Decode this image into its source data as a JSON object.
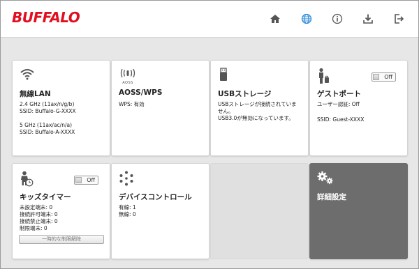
{
  "header": {
    "logo": "BUFFALO",
    "nav_icons": [
      "home-icon",
      "globe-icon",
      "info-icon",
      "download-icon",
      "logout-icon"
    ],
    "accent_color": "#e10f1f",
    "globe_color": "#2a8ad8"
  },
  "cards": {
    "wireless": {
      "title": "無線LAN",
      "band24": "2.4 GHz (11ax/n/g/b)",
      "ssid24": "SSID: Buffalo-G-XXXX",
      "band5": "5 GHz (11ax/ac/n/a)",
      "ssid5": "SSID: Buffalo-A-XXXX"
    },
    "aoss": {
      "icon_caption": "AOSS",
      "title": "AOSS/WPS",
      "wps": "WPS: 有効"
    },
    "usb": {
      "title": "USBストレージ",
      "line1": "USBストレージが接続されていま",
      "line2": "せん。",
      "line3": "USB3.0が無効になっています。"
    },
    "guest": {
      "title": "ゲストポート",
      "toggle": "Off",
      "auth": "ユーザー認証: Off",
      "ssid": "SSID: Guest-XXXX"
    },
    "kids": {
      "title": "キッズタイマー",
      "toggle": "Off",
      "unset": "未設定端末: 0",
      "allowed": "接続許可端末: 0",
      "blocked": "接続禁止端末: 0",
      "limited": "制限端末: 0",
      "release_button": "一時的な制限解除"
    },
    "device": {
      "title": "デバイスコントロール",
      "wired": "有線: 1",
      "wireless": "無線: 0"
    },
    "advanced": {
      "title": "詳細設定"
    }
  }
}
